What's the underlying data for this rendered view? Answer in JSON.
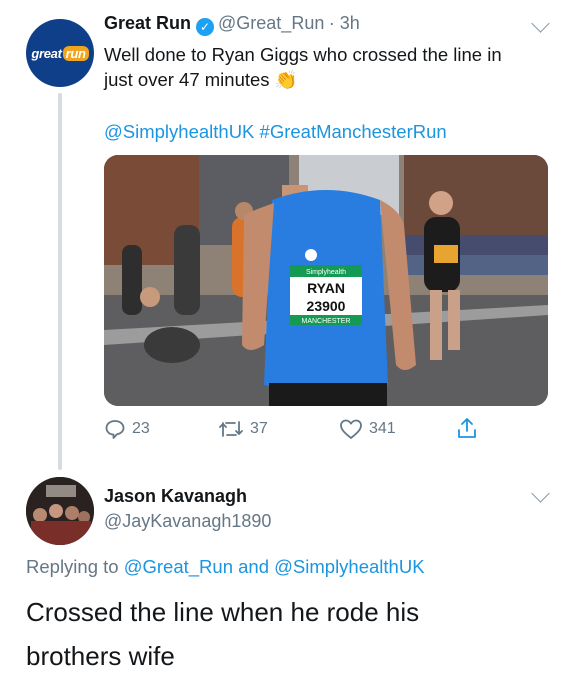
{
  "tweet": {
    "avatar_text": "great",
    "avatar_text2": "run",
    "author_name": "Great Run",
    "author_handle": "@Great_Run",
    "time": "· 3h",
    "text_line1": "Well done to Ryan Giggs who crossed the line in",
    "text_line2": "just over 47 minutes",
    "emoji": "👏",
    "mention": "@SimplyhealthUK",
    "hashtag": "#GreatManchesterRun",
    "media_bib_brand": "Simplyhealth",
    "media_bib_name": "RYAN",
    "media_bib_number": "23900",
    "media_bib_city": "MANCHESTER",
    "actions": {
      "replies": "23",
      "retweets": "37",
      "likes": "341"
    }
  },
  "reply": {
    "author_name": "Jason Kavanagh",
    "author_handle": "@JayKavanagh1890",
    "replying_prefix": "Replying to ",
    "replying_to_1": "@Great_Run",
    "replying_and": " and ",
    "replying_to_2": "@SimplyhealthUK",
    "text_line1": "Crossed the line when he rode his",
    "text_line2": "brothers wife"
  }
}
